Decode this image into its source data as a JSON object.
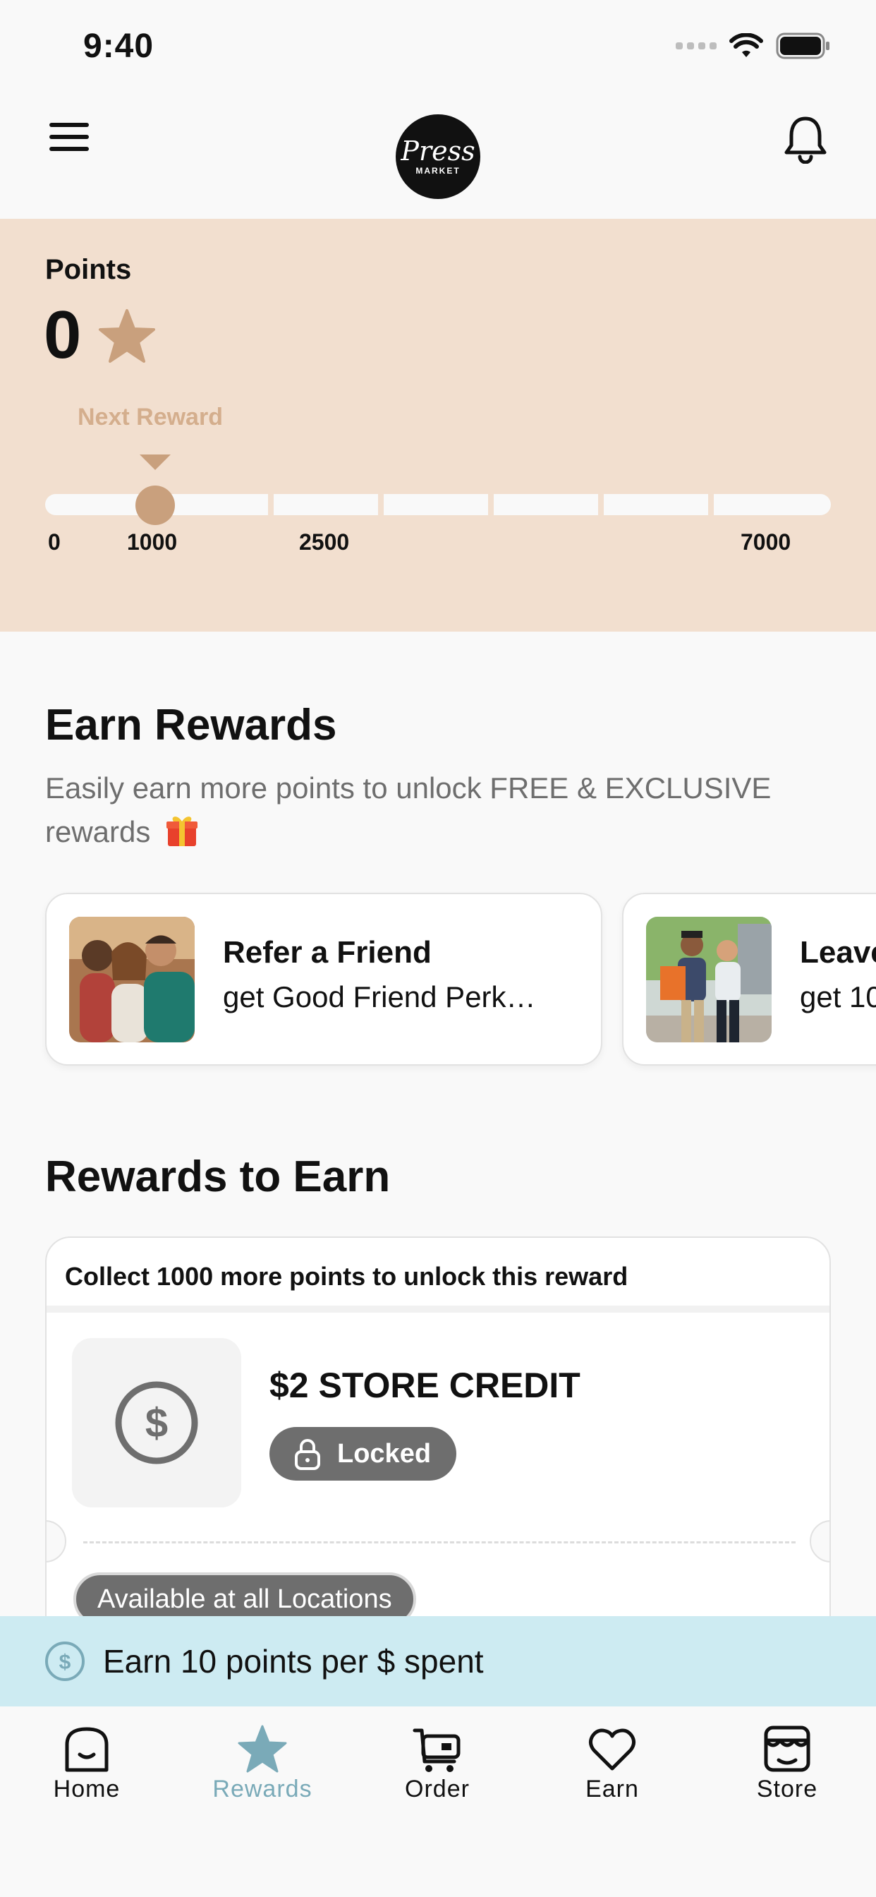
{
  "status_bar": {
    "time": "9:40"
  },
  "header": {
    "logo_text": "Press",
    "logo_subtext": "MARKET"
  },
  "points": {
    "label": "Points",
    "value": "0",
    "next_reward_label": "Next Reward",
    "progress_fraction": 0.0,
    "ticks": [
      "0",
      "1000",
      "2500",
      "7000"
    ]
  },
  "earn_rewards": {
    "title": "Earn Rewards",
    "subtitle": "Easily earn more points to unlock FREE & EXCLUSIVE rewards",
    "cards": [
      {
        "title": "Refer a Friend",
        "description": "get Good Friend Perk…"
      },
      {
        "title": "Leave",
        "description": "get 10"
      }
    ]
  },
  "rewards_to_earn": {
    "title": "Rewards to Earn",
    "reward": {
      "header": "Collect 1000 more points to unlock this reward",
      "title": "$2 STORE CREDIT",
      "status": "Locked",
      "availability": "Available at all Locations"
    }
  },
  "earn_banner": {
    "text": "Earn 10 points per $ spent"
  },
  "tabs": [
    {
      "label": "Home",
      "icon": "home-icon",
      "active": false
    },
    {
      "label": "Rewards",
      "icon": "star-icon",
      "active": true
    },
    {
      "label": "Order",
      "icon": "cart-icon",
      "active": false
    },
    {
      "label": "Earn",
      "icon": "heart-icon",
      "active": false
    },
    {
      "label": "Store",
      "icon": "store-icon",
      "active": false
    }
  ],
  "colors": {
    "points_panel_bg": "#f2dfcf",
    "accent_tan": "#c9a07d",
    "active_tab": "#7aaab8",
    "banner_bg": "#cdebf2",
    "badge_gray": "#6e6e6e"
  }
}
